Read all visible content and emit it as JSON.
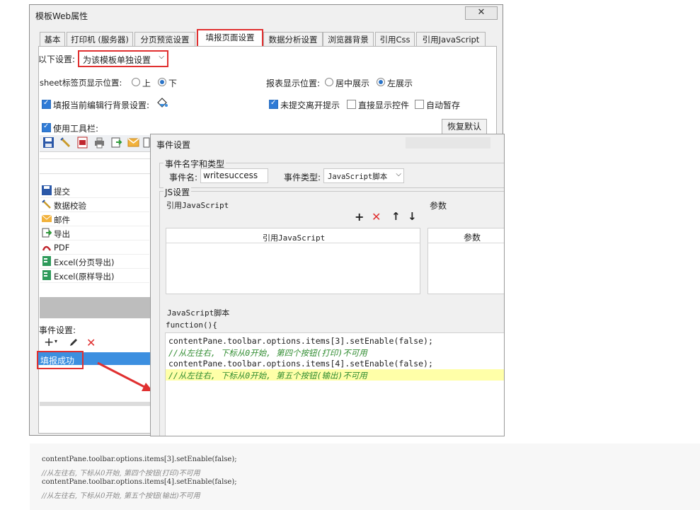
{
  "dialog": {
    "title": "模板Web属性",
    "close_glyph": "✕",
    "tabs": [
      {
        "label": "基本"
      },
      {
        "label": "打印机 (服务器)"
      },
      {
        "label": "分页预览设置"
      },
      {
        "label": "填报页面设置"
      },
      {
        "label": "数据分析设置"
      },
      {
        "label": "浏览器背景"
      },
      {
        "label": "引用Css"
      },
      {
        "label": "引用JavaScript"
      }
    ],
    "active_tab": "填报页面设置"
  },
  "settings": {
    "scope_label": "以下设置:",
    "scope_value": "为该模板单独设置",
    "sheet_tab_label": "sheet标签页显示位置:",
    "sheet_top": "上",
    "sheet_bottom": "下",
    "report_pos_label": "报表显示位置:",
    "report_center": "居中展示",
    "report_left": "左展示",
    "row_bg_label": "填报当前编辑行背景设置:",
    "unsubmitted_prompt": "未提交离开提示",
    "direct_controls": "直接显示控件",
    "auto_save": "自动暂存",
    "use_toolbar": "使用工具栏:",
    "restore_default": "恢复默认"
  },
  "tool_items": [
    {
      "label": "提交",
      "icon": "save-icon"
    },
    {
      "label": "数据校验",
      "icon": "check-pencil-icon"
    },
    {
      "label": "邮件",
      "icon": "mail-icon"
    },
    {
      "label": "导出",
      "icon": "export-icon"
    },
    {
      "label": "PDF",
      "icon": "pdf-icon"
    },
    {
      "label": "Excel(分页导出)",
      "icon": "excel-icon"
    },
    {
      "label": "Excel(原样导出)",
      "icon": "excel-icon"
    }
  ],
  "events": {
    "label": "事件设置:",
    "items": [
      "填报成功"
    ]
  },
  "event_dialog": {
    "title": "事件设置",
    "group_name_type": "事件名字和类型",
    "name_label": "事件名:",
    "name_value": "writesuccess",
    "type_label": "事件类型:",
    "type_value": "JavaScript脚本",
    "js_group": "JS设置",
    "ref_js_label": "引用JavaScript",
    "params_label": "参数",
    "col_ref_js": "引用JavaScript",
    "col_params": "参数",
    "script_label": "JavaScript脚本",
    "function_header": "function(){",
    "code": [
      {
        "text": "contentPane.toolbar.options.items[3].setEnable(false);",
        "type": "code"
      },
      {
        "text": "//从左往右, 下标从0开始, 第四个按钮(打印)不可用",
        "type": "comment"
      },
      {
        "text": "contentPane.toolbar.options.items[4].setEnable(false);",
        "type": "code"
      },
      {
        "text": "//从左往右, 下标从0开始, 第五个按钮(输出)不可用",
        "type": "comment"
      }
    ]
  },
  "code_block": [
    "contentPane.toolbar.options.items[3].setEnable(false);",
    "//从左往右, 下标从0开始, 第四个按钮(打印)不可用",
    "contentPane.toolbar.options.items[4].setEnable(false);",
    "//从左往右, 下标从0开始, 第五个按钮(输出)不可用"
  ],
  "colors": {
    "highlight_red": "#e03030",
    "selection_blue": "#3c8fe0",
    "accent_blue": "#2f7bd6",
    "comment_green": "#2e8b2e",
    "code_highlight_yellow": "#ffffa8"
  }
}
